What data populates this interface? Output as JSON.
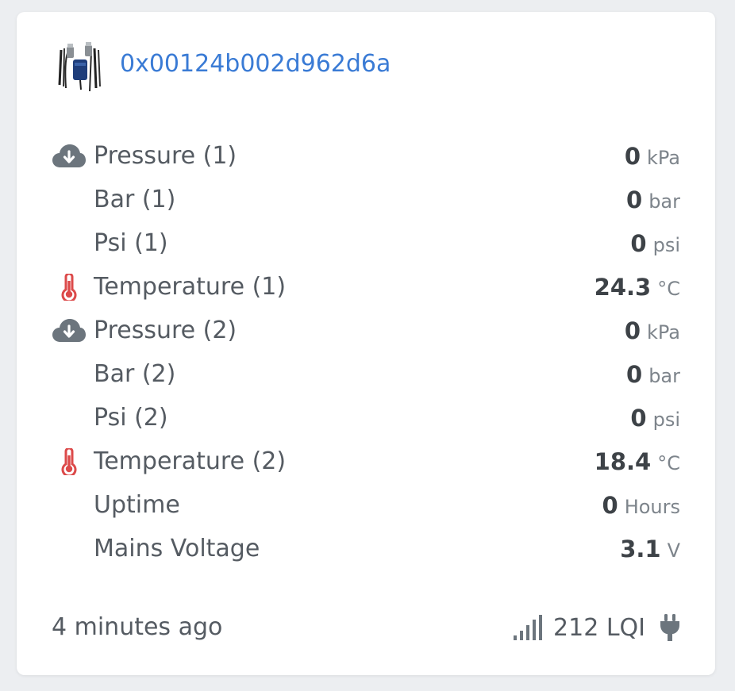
{
  "device": {
    "title": "0x00124b002d962d6a",
    "image_icon": "device-sensor-image"
  },
  "readings": [
    {
      "icon": "cloud-download-icon",
      "label": "Pressure (1)",
      "value": "0",
      "unit": "kPa"
    },
    {
      "icon": "",
      "label": "Bar (1)",
      "value": "0",
      "unit": "bar"
    },
    {
      "icon": "",
      "label": "Psi (1)",
      "value": "0",
      "unit": "psi"
    },
    {
      "icon": "thermometer-icon",
      "label": "Temperature (1)",
      "value": "24.3",
      "unit": "°C"
    },
    {
      "icon": "cloud-download-icon",
      "label": "Pressure (2)",
      "value": "0",
      "unit": "kPa"
    },
    {
      "icon": "",
      "label": "Bar (2)",
      "value": "0",
      "unit": "bar"
    },
    {
      "icon": "",
      "label": "Psi (2)",
      "value": "0",
      "unit": "psi"
    },
    {
      "icon": "thermometer-icon",
      "label": "Temperature (2)",
      "value": "18.4",
      "unit": "°C"
    },
    {
      "icon": "",
      "label": "Uptime",
      "value": "0",
      "unit": "Hours"
    },
    {
      "icon": "",
      "label": "Mains Voltage",
      "value": "3.1",
      "unit": "V"
    }
  ],
  "footer": {
    "last_seen": "4 minutes ago",
    "lqi": "212 LQI",
    "signal_icon": "signal-bars-icon",
    "power_icon": "plug-icon"
  },
  "colors": {
    "link": "#3a7bd5",
    "cloud_icon": "#6c757d",
    "thermometer_icon": "#dc4a4a"
  }
}
